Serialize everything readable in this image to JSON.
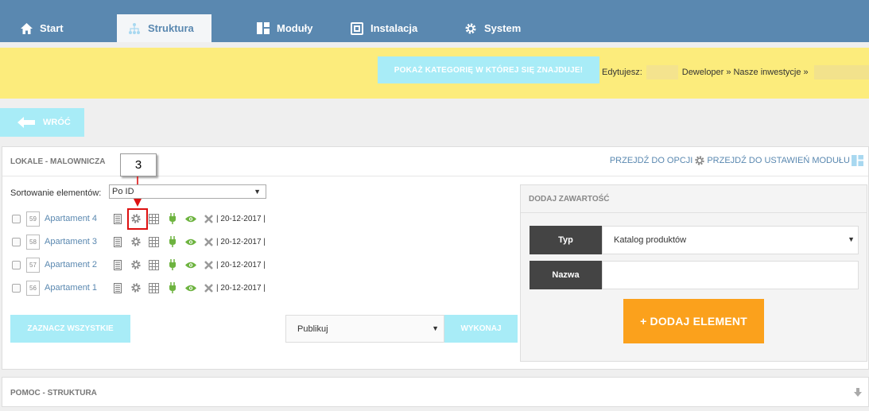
{
  "nav": {
    "tabs": [
      {
        "label": "Start",
        "icon": "home-icon"
      },
      {
        "label": "Struktura",
        "icon": "structure-icon"
      },
      {
        "label": "Moduły",
        "icon": "modules-icon"
      },
      {
        "label": "Instalacja",
        "icon": "installation-icon"
      },
      {
        "label": "System",
        "icon": "gear-icon"
      }
    ],
    "active_tab": "Struktura"
  },
  "toolbar": {
    "show_category_label": "POKAŻ KATEGORIĘ W KTÓREJ SIĘ ZNAJDUJE!",
    "editing_label": "Edytujesz:",
    "path_1": "Deweloper",
    "path_2": "Nasze inwestycje"
  },
  "back_label": "WRÓĆ",
  "panel": {
    "title": "LOKALE - MALOWNICZA",
    "goto_options": "PRZEJDŹ DO OPCJI",
    "goto_module_settings": "PRZEJDŹ DO USTAWIEŃ MODUŁU",
    "sort_label": "Sortowanie elementów:",
    "sort_value": "Po ID",
    "items": [
      {
        "id": "59",
        "name": "Apartament 4",
        "date": "| 20-12-2017 |"
      },
      {
        "id": "58",
        "name": "Apartament 3",
        "date": "| 20-12-2017 |"
      },
      {
        "id": "57",
        "name": "Apartament 2",
        "date": "| 20-12-2017 |"
      },
      {
        "id": "56",
        "name": "Apartament 1",
        "date": "| 20-12-2017 |"
      }
    ],
    "select_all_label": "ZAZNACZ WSZYSTKIE",
    "action_value": "Publikuj",
    "execute_label": "WYKONAJ",
    "callout_number": "3"
  },
  "add_content": {
    "title": "DODAJ ZAWARTOŚĆ",
    "type_label": "Typ",
    "type_value": "Katalog produktów",
    "name_label": "Nazwa",
    "name_value": "",
    "add_button": "+ DODAJ ELEMENT"
  },
  "help": {
    "title": "POMOC - STRUKTURA"
  },
  "colors": {
    "nav_bg": "#5a88b0",
    "yellow_bar": "#fcec7c",
    "light_button": "#a8ecf7",
    "orange_button": "#fba11c",
    "link": "#5a88b0",
    "highlight": "#dd1111",
    "eye_green": "#6db33f"
  }
}
